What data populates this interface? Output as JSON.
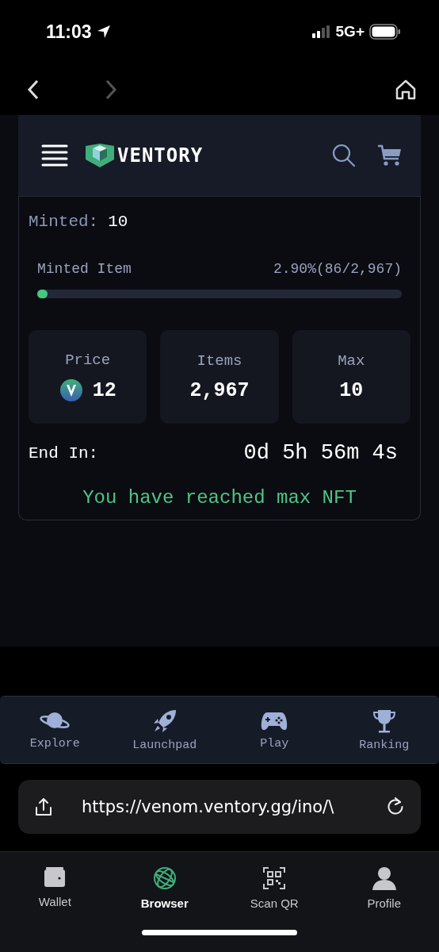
{
  "status_bar": {
    "time": "11:03",
    "network": "5G+"
  },
  "browser_nav": {
    "back_disabled": false,
    "forward_disabled": true
  },
  "header": {
    "logo": "VENTORY"
  },
  "mint": {
    "minted_label": "Minted:",
    "minted_value": "10",
    "progress_label": "Minted Item",
    "progress_reading": "2.90%(86/2,967)",
    "level": 0.029,
    "stats": [
      {
        "label": "Price",
        "value": "12",
        "kind": "token"
      },
      {
        "label": "Items",
        "value": "2,967",
        "kind": "plain"
      },
      {
        "label": "Max",
        "value": "10",
        "kind": "plain"
      }
    ],
    "end_label": "End In:",
    "countdown": "0d 5h 56m 4s",
    "notice": "You have reached max NFT"
  },
  "site_nav": [
    {
      "label": "Explore",
      "kind": "planet"
    },
    {
      "label": "Launchpad",
      "kind": "rocket"
    },
    {
      "label": "Play",
      "kind": "gamepad"
    },
    {
      "label": "Ranking",
      "kind": "trophy"
    }
  ],
  "address_bar": {
    "url": "https://venom.ventory.gg/ino/\\"
  },
  "tab_bar": [
    {
      "label": "Wallet",
      "kind": "wallet",
      "selected": false
    },
    {
      "label": "Browser",
      "kind": "globe",
      "selected": true
    },
    {
      "label": "Scan QR",
      "kind": "qr",
      "selected": false
    },
    {
      "label": "Profile",
      "kind": "person",
      "selected": false
    }
  ]
}
